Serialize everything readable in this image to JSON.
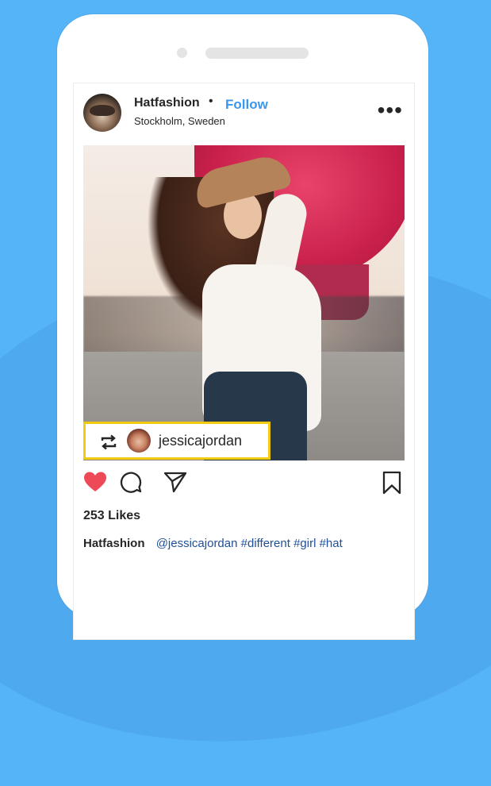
{
  "post": {
    "username": "Hatfashion",
    "bullet": "•",
    "follow_label": "Follow",
    "location": "Stockholm, Sweden",
    "more_label": "•••",
    "tag": {
      "username": "jessicajordan"
    },
    "likes": "253 Likes",
    "caption": {
      "username": "Hatfashion",
      "text": "@jessicajordan #different #girl #hat"
    }
  },
  "colors": {
    "background": "#55b3f7",
    "follow": "#3897f0",
    "like_heart": "#ed4956",
    "tag_border": "#f1cb0f",
    "caption_text": "#1f4f9a"
  },
  "icons": [
    "repost-icon",
    "heart-icon",
    "comment-icon",
    "share-icon",
    "bookmark-icon",
    "more-icon"
  ]
}
